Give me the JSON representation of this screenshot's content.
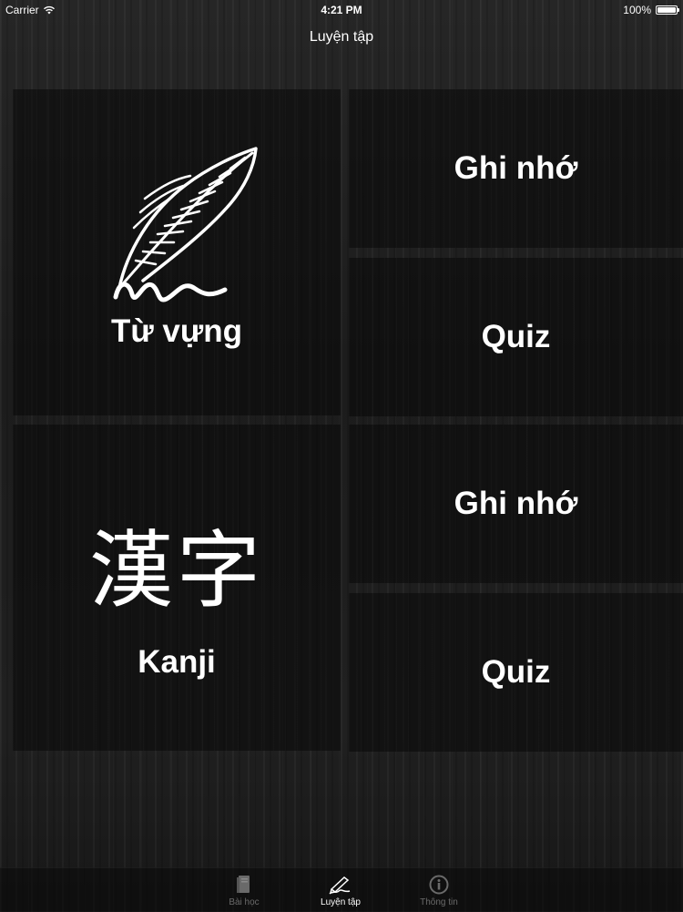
{
  "status_bar": {
    "carrier": "Carrier",
    "time": "4:21 PM",
    "battery": "100%",
    "wifi_icon": "wifi-icon",
    "battery_icon": "battery-icon"
  },
  "nav": {
    "title": "Luyện tập"
  },
  "vocabulary": {
    "icon": "feather-quill-icon",
    "label": "Từ vựng",
    "memorize_label": "Ghi nhớ",
    "quiz_label": "Quiz"
  },
  "kanji": {
    "glyph": "漢字",
    "label": "Kanji",
    "memorize_label": "Ghi nhớ",
    "quiz_label": "Quiz"
  },
  "tab_bar": {
    "tabs": [
      {
        "label": "Bài học",
        "icon": "book-icon",
        "active": false
      },
      {
        "label": "Luyện tập",
        "icon": "pencil-icon",
        "active": true
      },
      {
        "label": "Thông tin",
        "icon": "info-icon",
        "active": false
      }
    ]
  },
  "colors": {
    "text": "#ffffff",
    "background": "#1e1e1e",
    "inactive_tab": "#6a6a6a"
  }
}
